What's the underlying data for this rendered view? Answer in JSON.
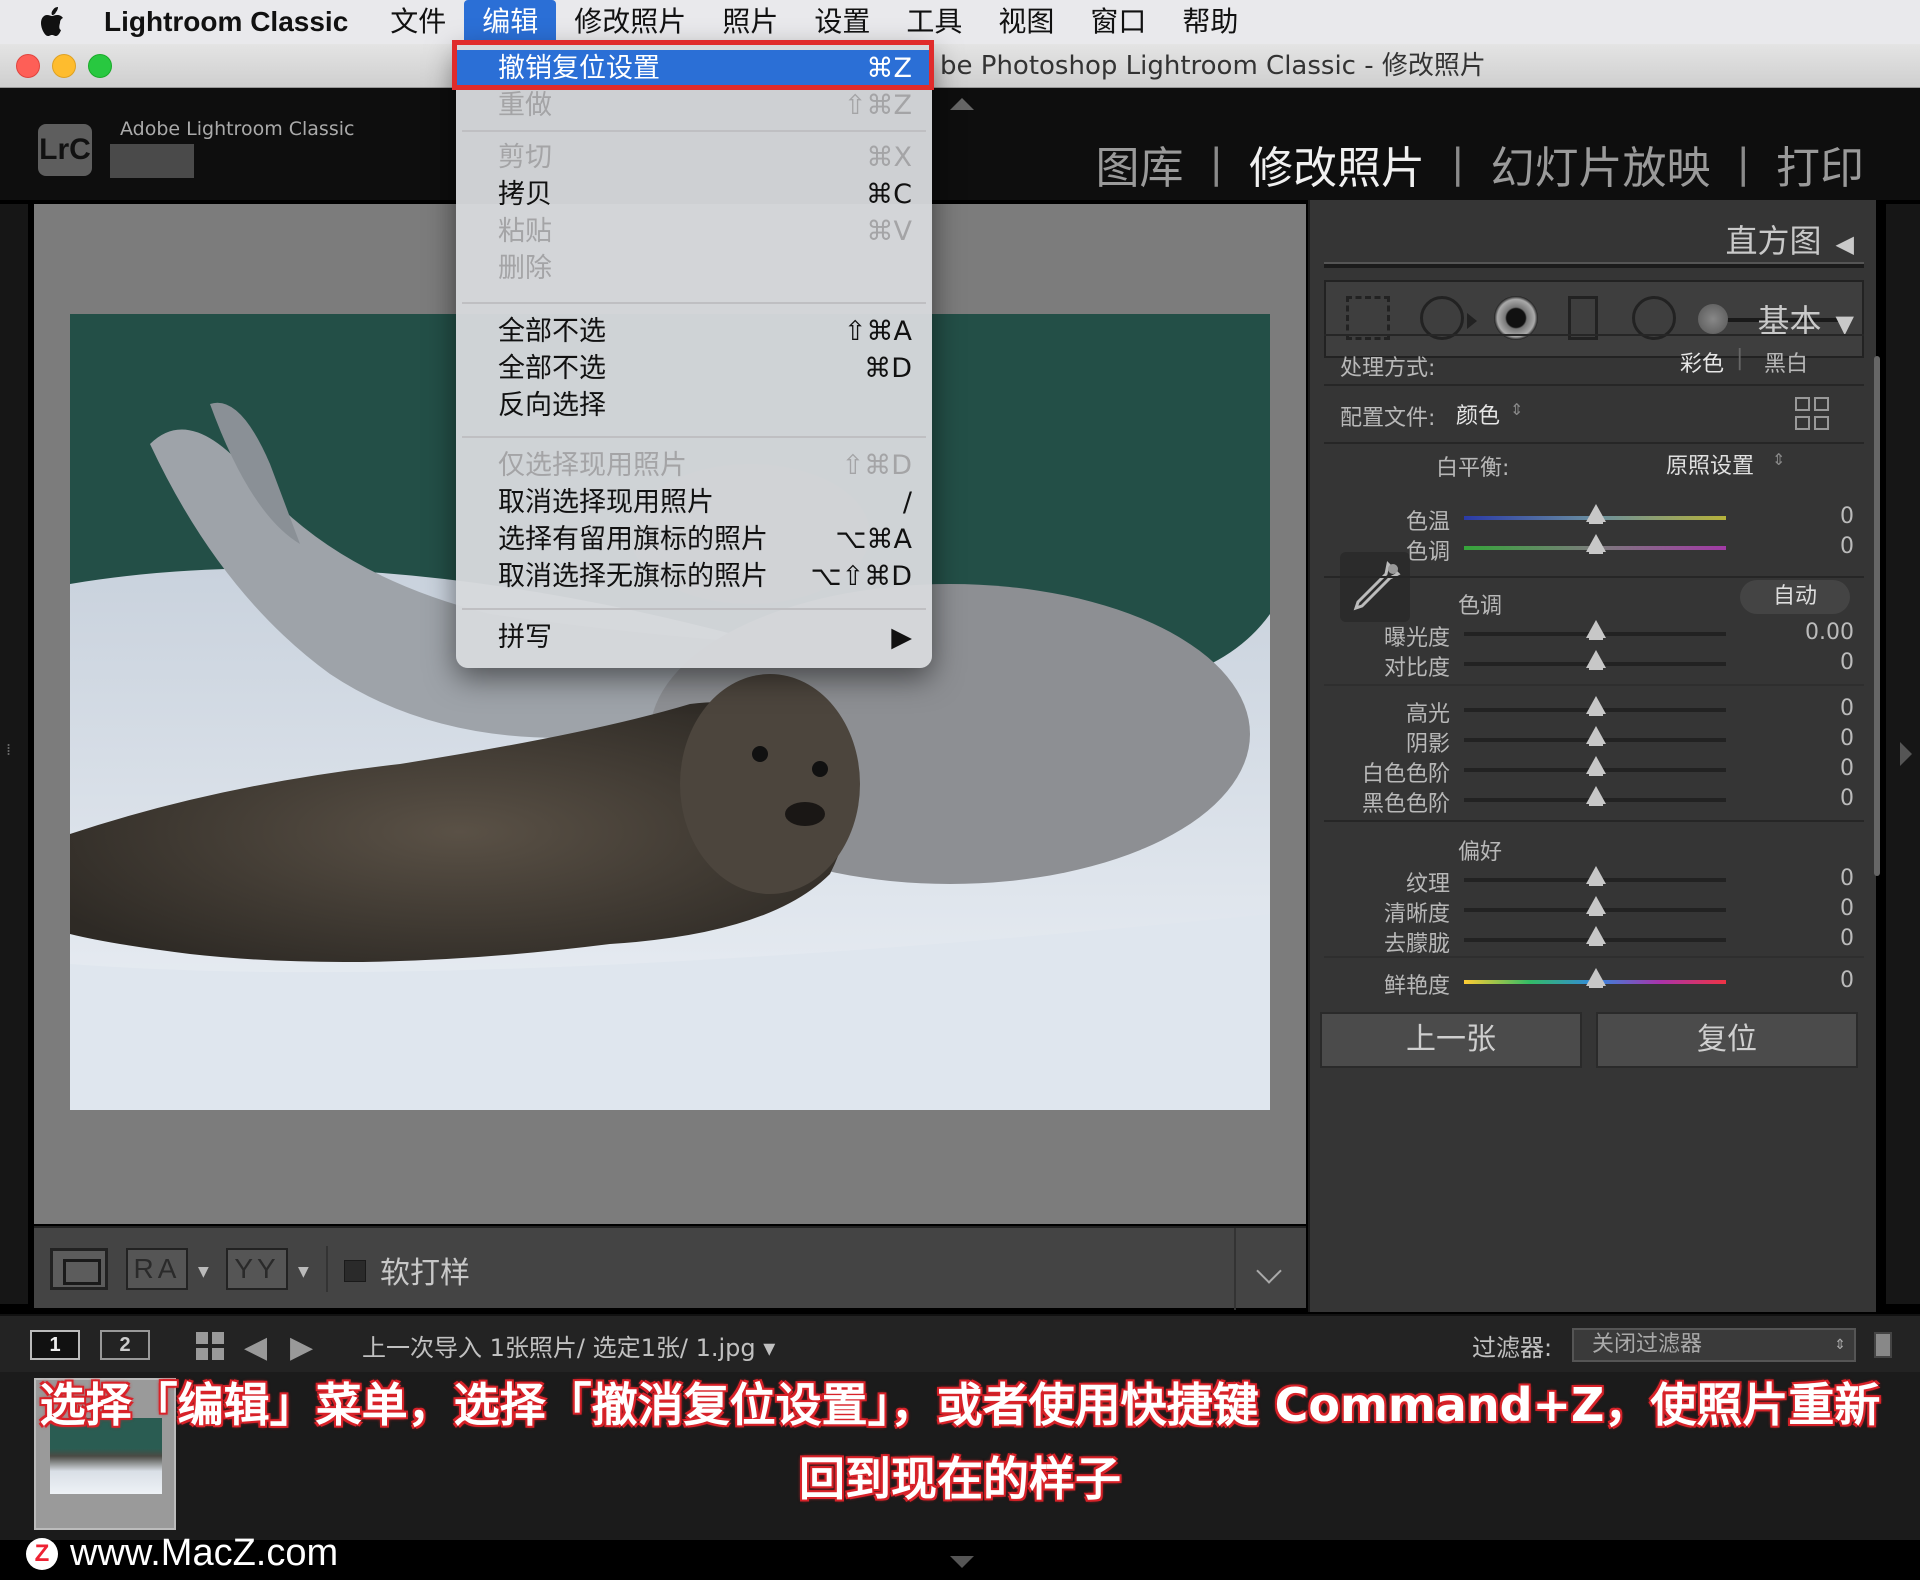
{
  "menubar": {
    "app_name": "Lightroom Classic",
    "menus": [
      "文件",
      "编辑",
      "修改照片",
      "照片",
      "设置",
      "工具",
      "视图",
      "窗口",
      "帮助"
    ],
    "active_menu": "编辑"
  },
  "window": {
    "title": "be Photoshop Lightroom Classic - 修改照片"
  },
  "header": {
    "badge": "LrC",
    "subtitle": "Adobe Lightroom Classic",
    "modules": [
      "图库",
      "修改照片",
      "幻灯片放映",
      "打印"
    ],
    "separator": "|",
    "active_module": "修改照片"
  },
  "edit_menu": {
    "items": [
      {
        "label": "撤销复位设置",
        "shortcut": "⌘Z",
        "enabled": true,
        "highlighted": true
      },
      {
        "label": "重做",
        "shortcut": "⇧⌘Z",
        "enabled": false
      },
      {
        "label": "剪切",
        "shortcut": "⌘X",
        "enabled": false
      },
      {
        "label": "拷贝",
        "shortcut": "⌘C",
        "enabled": true
      },
      {
        "label": "粘贴",
        "shortcut": "⌘V",
        "enabled": false
      },
      {
        "label": "删除",
        "shortcut": "",
        "enabled": false
      },
      {
        "label": "全部不选",
        "shortcut": "⇧⌘A",
        "enabled": true
      },
      {
        "label": "全部不选",
        "shortcut": "⌘D",
        "enabled": true
      },
      {
        "label": "反向选择",
        "shortcut": "",
        "enabled": true
      },
      {
        "label": "仅选择现用照片",
        "shortcut": "⇧⌘D",
        "enabled": false
      },
      {
        "label": "取消选择现用照片",
        "shortcut": "/",
        "enabled": true
      },
      {
        "label": "选择有留用旗标的照片",
        "shortcut": "⌥⌘A",
        "enabled": true
      },
      {
        "label": "取消选择无旗标的照片",
        "shortcut": "⌥⇧⌘D",
        "enabled": true
      },
      {
        "label": "拼写",
        "shortcut": "▶",
        "enabled": true
      }
    ]
  },
  "toolbar": {
    "ra_label": "RA",
    "yy_label": "YY",
    "soft_proof_label": "软打样"
  },
  "right_panel": {
    "histogram_label": "直方图",
    "histogram_toggle": "◀",
    "basic_label": "基本",
    "basic_toggle": "▼",
    "treatment_label": "处理方式:",
    "treatment_color": "彩色",
    "treatment_bw": "黑白",
    "treatment_sep": "|",
    "profile_label": "配置文件:",
    "profile_value": "颜色",
    "profile_stepper": "⇕",
    "wb_label": "白平衡:",
    "wb_value": "原照设置",
    "wb_stepper": "⇕",
    "temp_label": "色温",
    "temp_value": "0",
    "tint_label": "色调",
    "tint_value": "0",
    "tone_label": "色调",
    "auto_label": "自动",
    "exposure_label": "曝光度",
    "exposure_value": "0.00",
    "contrast_label": "对比度",
    "contrast_value": "0",
    "highlights_label": "高光",
    "highlights_value": "0",
    "shadows_label": "阴影",
    "shadows_value": "0",
    "whites_label": "白色色阶",
    "whites_value": "0",
    "blacks_label": "黑色色阶",
    "blacks_value": "0",
    "presence_label": "偏好",
    "texture_label": "纹理",
    "texture_value": "0",
    "clarity_label": "清晰度",
    "clarity_value": "0",
    "dehaze_label": "去朦胧",
    "dehaze_value": "0",
    "vibrance_label": "鲜艳度",
    "vibrance_value": "0",
    "prev_button": "上一张",
    "reset_button": "复位"
  },
  "filmbar": {
    "screen1": "1",
    "screen2": "2",
    "back_arrow": "🡐",
    "fwd_arrow": "🡒",
    "source": "上一次导入  1张照片/ 选定1张/ 1.jpg ▾",
    "filter_label": "过滤器:",
    "filter_value": "关闭过滤器",
    "filter_arrows": "⇕"
  },
  "caption": {
    "line1": "选择「编辑」菜单，选择「撤消复位设置」，或者使用快捷键 Command+Z，使照片重新",
    "line2": "回到现在的样子"
  },
  "watermark": {
    "logo": "Z",
    "text": "www.MacZ.com"
  },
  "colors": {
    "accent_blue": "#2b6fd6",
    "highlight_outline": "#e02b2b",
    "caption_outline": "#d8232a"
  }
}
